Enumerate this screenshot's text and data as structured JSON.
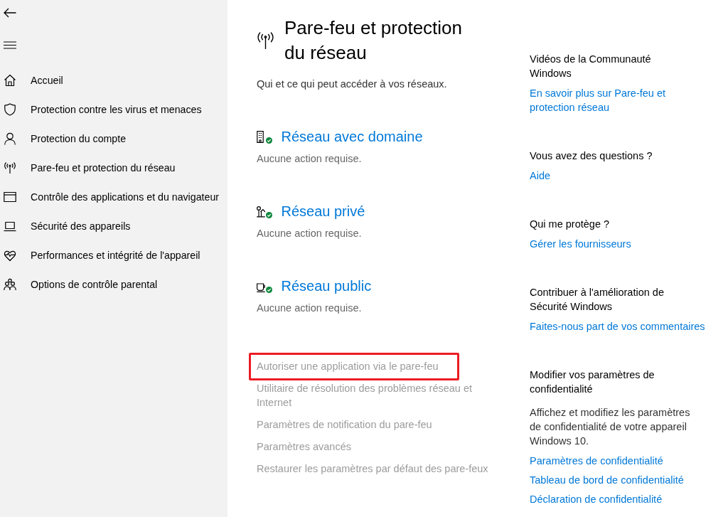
{
  "sidebar": {
    "items": [
      "Accueil",
      "Protection contre les virus et menaces",
      "Protection du compte",
      "Pare-feu et protection du réseau",
      "Contrôle des applications et du navigateur",
      "Sécurité des appareils",
      "Performances et intégrité de l'appareil",
      "Options de contrôle parental"
    ]
  },
  "header": {
    "title": "Pare-feu et protection du réseau",
    "subtitle": "Qui et ce qui peut accéder à vos réseaux."
  },
  "networks": [
    {
      "name": "Réseau avec domaine",
      "status": "Aucune action requise.",
      "ok": true
    },
    {
      "name": "Réseau privé",
      "status": "Aucune action requise.",
      "ok": true
    },
    {
      "name": "Réseau public",
      "status": "Aucune action requise.",
      "ok": true
    }
  ],
  "links": [
    {
      "label": "Autoriser une application via le pare-feu",
      "disabled": true,
      "highlighted": true
    },
    {
      "label": "Utilitaire de résolution des problèmes réseau et Internet",
      "disabled": true,
      "highlighted": false
    },
    {
      "label": "Paramètres de notification du pare-feu",
      "disabled": true,
      "highlighted": false
    },
    {
      "label": "Paramètres avancés",
      "disabled": true,
      "highlighted": false
    },
    {
      "label": "Restaurer les paramètres par défaut des pare-feux",
      "disabled": true,
      "highlighted": false
    }
  ],
  "aside": {
    "sections": [
      {
        "title": "Vidéos de la Communauté Windows",
        "links": [
          "En savoir plus sur Pare-feu et protection réseau"
        ]
      },
      {
        "title": "Vous avez des questions ?",
        "links": [
          "Aide"
        ]
      },
      {
        "title": "Qui me protège ?",
        "links": [
          "Gérer les fournisseurs"
        ]
      },
      {
        "title": "Contribuer à l'amélioration de Sécurité Windows",
        "links": [
          "Faites-nous part de vos commentaires"
        ]
      },
      {
        "title": "Modifier vos paramètres de confidentialité",
        "description": "Affichez et modifiez les paramètres de confidentialité de votre appareil Windows 10.",
        "links": [
          "Paramètres de confidentialité",
          "Tableau de bord de confidentialité",
          "Déclaration de confidentialité"
        ]
      }
    ]
  }
}
